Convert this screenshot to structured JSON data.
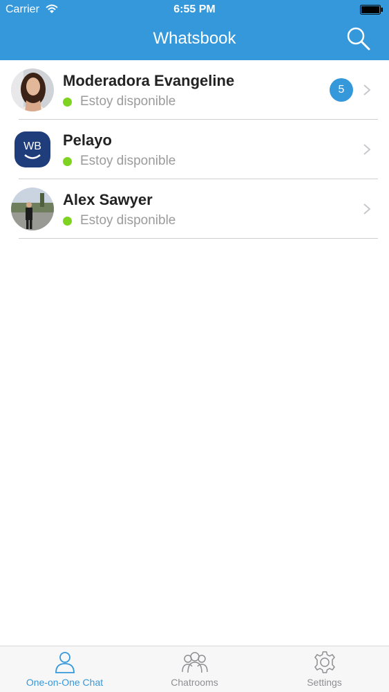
{
  "status_bar": {
    "carrier": "Carrier",
    "time": "6:55 PM"
  },
  "nav": {
    "title": "Whatsbook",
    "search_icon": "search-icon"
  },
  "chats": [
    {
      "name": "Moderadora Evangeline",
      "status": "Estoy disponible",
      "badge": "5",
      "presence_color": "#7ed321"
    },
    {
      "name": "Pelayo",
      "status": "Estoy disponible",
      "badge": "",
      "presence_color": "#7ed321",
      "avatar_text": "WB"
    },
    {
      "name": "Alex Sawyer",
      "status": "Estoy disponible",
      "badge": "",
      "presence_color": "#7ed321"
    }
  ],
  "tabs": [
    {
      "label": "One-on-One Chat",
      "icon": "person-icon",
      "active": true
    },
    {
      "label": "Chatrooms",
      "icon": "group-icon",
      "active": false
    },
    {
      "label": "Settings",
      "icon": "gear-icon",
      "active": false
    }
  ],
  "colors": {
    "accent": "#3498db",
    "presence": "#7ed321",
    "secondary_text": "#9b9b9b"
  }
}
